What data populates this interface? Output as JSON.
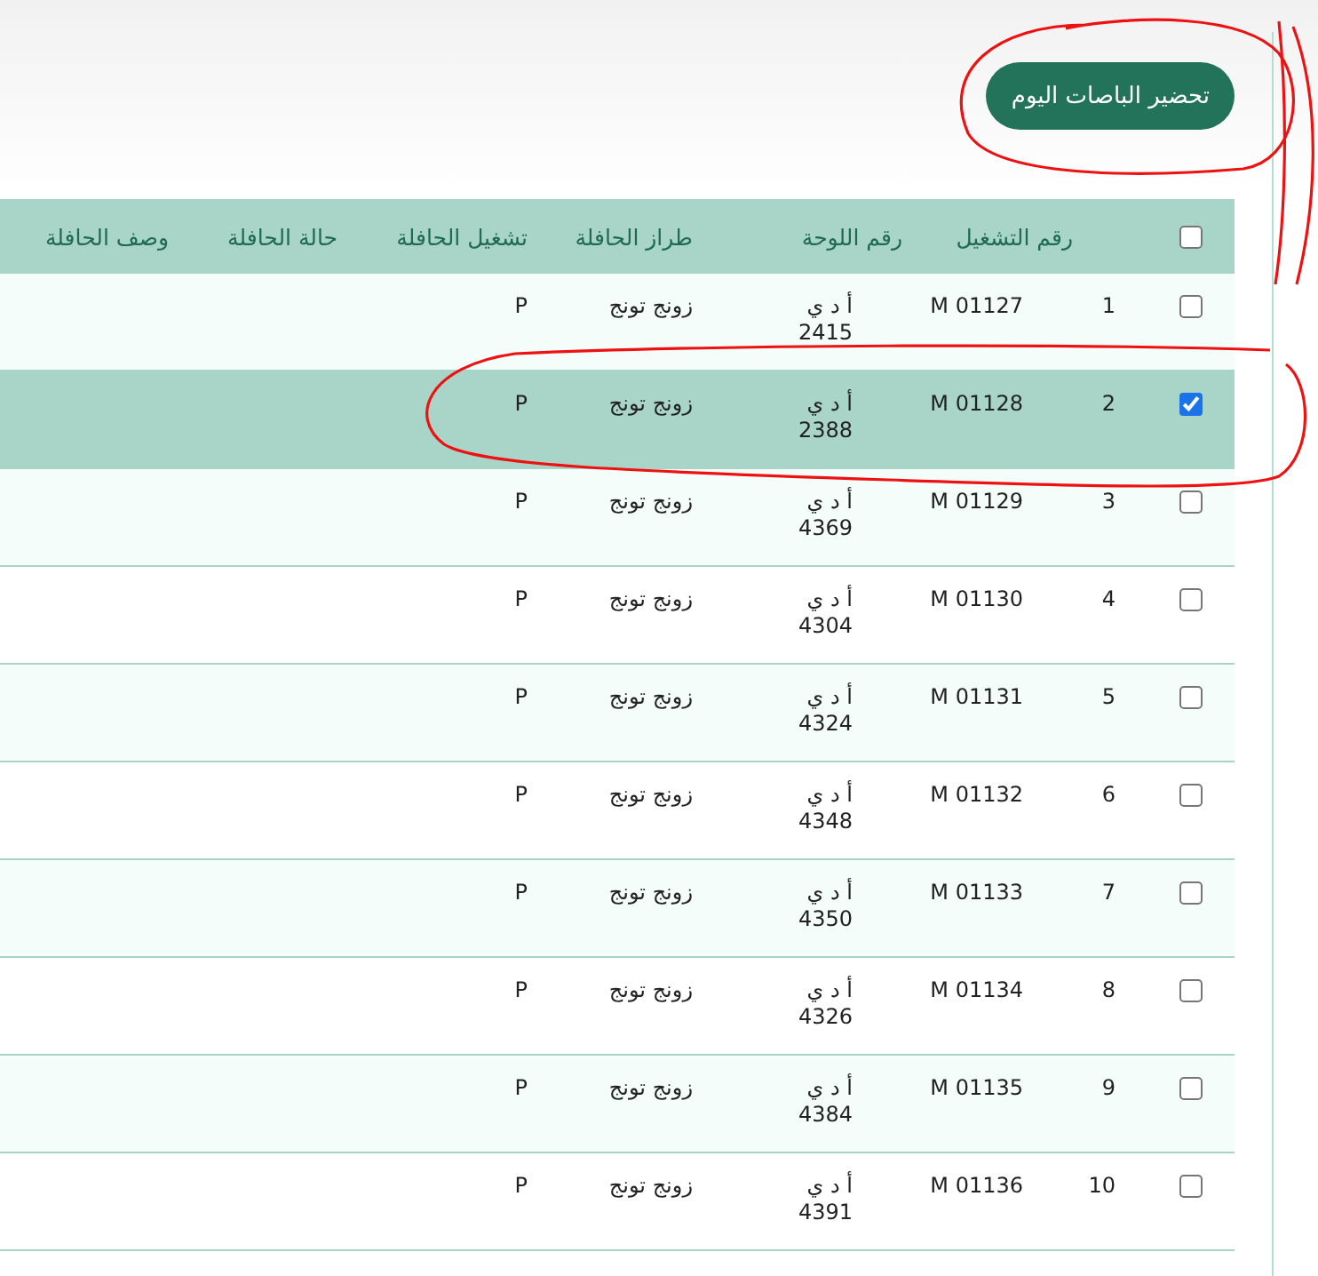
{
  "action_button": {
    "label": "تحضير الباصات اليوم"
  },
  "table": {
    "select_all": {
      "checked": false
    },
    "columns": [
      "",
      "رقم التشغيل",
      "رقم اللوحة",
      "طراز الحافلة",
      "تشغيل الحافلة",
      "حالة الحافلة",
      "وصف الحافلة"
    ],
    "rows": [
      {
        "selected": false,
        "cells": [
          "1",
          "M 01127",
          "أ د ي 2415",
          "زونج تونج",
          "P",
          "",
          ""
        ]
      },
      {
        "selected": true,
        "cells": [
          "2",
          "M 01128",
          "أ د ي 2388",
          "زونج تونج",
          "P",
          "",
          ""
        ]
      },
      {
        "selected": false,
        "cells": [
          "3",
          "M 01129",
          "أ د ي 4369",
          "زونج تونج",
          "P",
          "",
          ""
        ]
      },
      {
        "selected": false,
        "cells": [
          "4",
          "M 01130",
          "أ د ي 4304",
          "زونج تونج",
          "P",
          "",
          ""
        ]
      },
      {
        "selected": false,
        "cells": [
          "5",
          "M 01131",
          "أ د ي 4324",
          "زونج تونج",
          "P",
          "",
          ""
        ]
      },
      {
        "selected": false,
        "cells": [
          "6",
          "M 01132",
          "أ د ي 4348",
          "زونج تونج",
          "P",
          "",
          ""
        ]
      },
      {
        "selected": false,
        "cells": [
          "7",
          "M 01133",
          "أ د ي 4350",
          "زونج تونج",
          "P",
          "",
          ""
        ]
      },
      {
        "selected": false,
        "cells": [
          "8",
          "M 01134",
          "أ د ي 4326",
          "زونج تونج",
          "P",
          "",
          ""
        ]
      },
      {
        "selected": false,
        "cells": [
          "9",
          "M 01135",
          "أ د ي 4384",
          "زونج تونج",
          "P",
          "",
          ""
        ]
      },
      {
        "selected": false,
        "cells": [
          "10",
          "M 01136",
          "أ د ي 4391",
          "زونج تونج",
          "P",
          "",
          ""
        ]
      }
    ]
  }
}
